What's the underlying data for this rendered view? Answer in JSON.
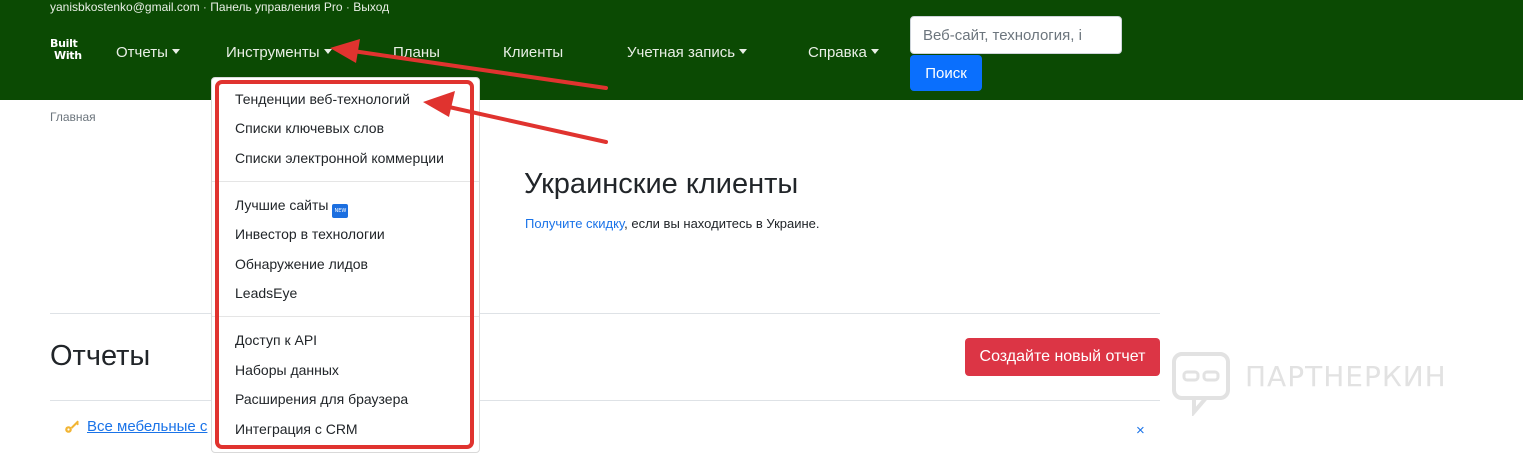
{
  "header": {
    "user_email": "yanisbkostenko@gmail.com",
    "separator": "·",
    "panel_link": "Панель управления Pro",
    "logout_link": "Выход",
    "logo_line1": "Built",
    "logo_line2": "With",
    "nav": {
      "reports": "Отчеты",
      "tools": "Инструменты",
      "plans": "Планы",
      "clients": "Клиенты",
      "account": "Учетная запись",
      "help": "Справка"
    },
    "search_placeholder": "Веб-сайт, технология, i",
    "search_button": "Поиск"
  },
  "breadcrumb": "Главная",
  "main": {
    "title": "Украинские клиенты",
    "discount_link": "Получите скидку",
    "discount_rest": ", если вы находитесь в Украине."
  },
  "reports": {
    "title": "Отчеты",
    "new_report_button": "Создайте новый отчет",
    "all_link": "Все мебельные с",
    "close": "×"
  },
  "dropdown": {
    "items": [
      "Тенденции веб-технологий",
      "Списки ключевых слов",
      "Списки электронной коммерции",
      "Лучшие сайты",
      "Инвестор в технологии",
      "Обнаружение лидов",
      "LeadsEye",
      "Доступ к API",
      "Наборы данных",
      "Расширения для браузера",
      "Интеграция с CRM"
    ],
    "new_badge": "NEW"
  },
  "watermark": "ПАРТНЕРКИН",
  "colors": {
    "header_bg": "#0b4a03",
    "primary": "#0a6ffd",
    "danger": "#dc3545",
    "annotation": "#e0332f",
    "link": "#1a73e8"
  }
}
